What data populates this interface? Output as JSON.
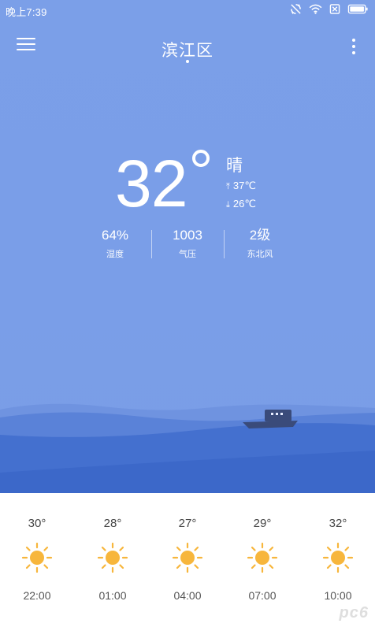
{
  "status": {
    "time": "晚上7:39",
    "icons": [
      "sync-off-icon",
      "wifi-icon",
      "no-sim-icon",
      "battery-icon"
    ]
  },
  "header": {
    "city": "滨江区",
    "menu_icon": "menu-icon",
    "more_icon": "more-vert-icon"
  },
  "current": {
    "temperature": "32",
    "condition": "晴",
    "high": "37℃",
    "low": "26℃",
    "stats": [
      {
        "value": "64%",
        "label": "湿度"
      },
      {
        "value": "1003",
        "label": "气压"
      },
      {
        "value": "2级",
        "label": "东北风"
      }
    ]
  },
  "hourly": [
    {
      "temp": "30°",
      "time": "22:00",
      "icon": "sun-icon"
    },
    {
      "temp": "28°",
      "time": "01:00",
      "icon": "sun-icon"
    },
    {
      "temp": "27°",
      "time": "04:00",
      "icon": "sun-icon"
    },
    {
      "temp": "29°",
      "time": "07:00",
      "icon": "sun-icon"
    },
    {
      "temp": "32°",
      "time": "10:00",
      "icon": "sun-icon"
    }
  ],
  "colors": {
    "sky": "#7a9de6",
    "wave_front": "#3d68c9",
    "sun": "#f7b63c"
  },
  "watermark": "pc6"
}
